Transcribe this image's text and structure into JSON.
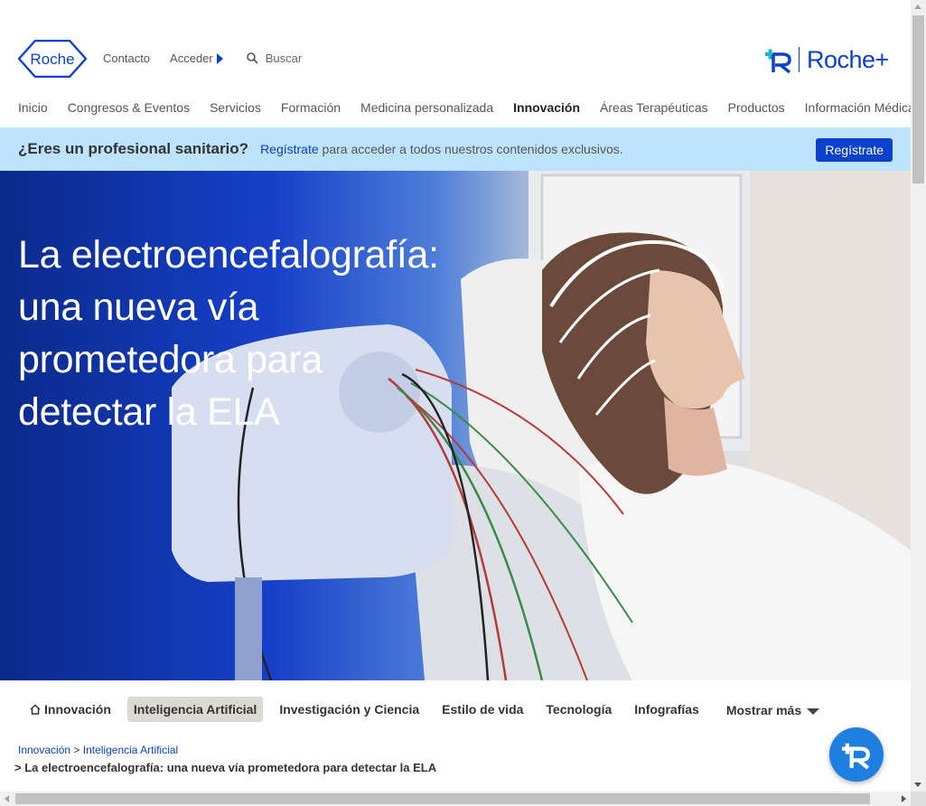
{
  "header": {
    "logo_text": "Roche",
    "contact_label": "Contacto",
    "login_label": "Acceder",
    "search_label": "Buscar",
    "rocheplus_label": "Roche+"
  },
  "nav": {
    "items": [
      {
        "label": "Inicio"
      },
      {
        "label": "Congresos & Eventos"
      },
      {
        "label": "Servicios"
      },
      {
        "label": "Formación"
      },
      {
        "label": "Medicina personalizada"
      },
      {
        "label": "Innovación"
      },
      {
        "label": "Áreas Terapéuticas"
      },
      {
        "label": "Productos"
      },
      {
        "label": "Información Médica"
      }
    ],
    "active": "Innovación"
  },
  "banner": {
    "question": "¿Eres un profesional sanitario?",
    "link_text": "Regístrate",
    "message": " para acceder a todos nuestros contenidos exclusivos.",
    "button_label": "Regístrate"
  },
  "hero": {
    "title": "La electroencefalografía: una nueva vía prometedora para detectar la ELA"
  },
  "subnav": {
    "home": "Innovación",
    "items": [
      {
        "label": "Inteligencia Artificial"
      },
      {
        "label": "Investigación y Ciencia"
      },
      {
        "label": "Estilo de vida"
      },
      {
        "label": "Tecnología"
      },
      {
        "label": "Infografías"
      }
    ],
    "selected": "Inteligencia Artificial",
    "more_label": "Mostrar más"
  },
  "breadcrumb": {
    "level1": "Innovación",
    "separator": ">",
    "level2": "Inteligencia Artificial",
    "current_prefix": ">",
    "current": "La electroencefalografía: una nueva vía prometedora para detectar la ELA"
  },
  "colors": {
    "brand_blue": "#0b41cd",
    "banner_bg": "#bde3ff",
    "fab_blue": "#1f7fe0",
    "pill_bg": "#dcd9d2"
  }
}
